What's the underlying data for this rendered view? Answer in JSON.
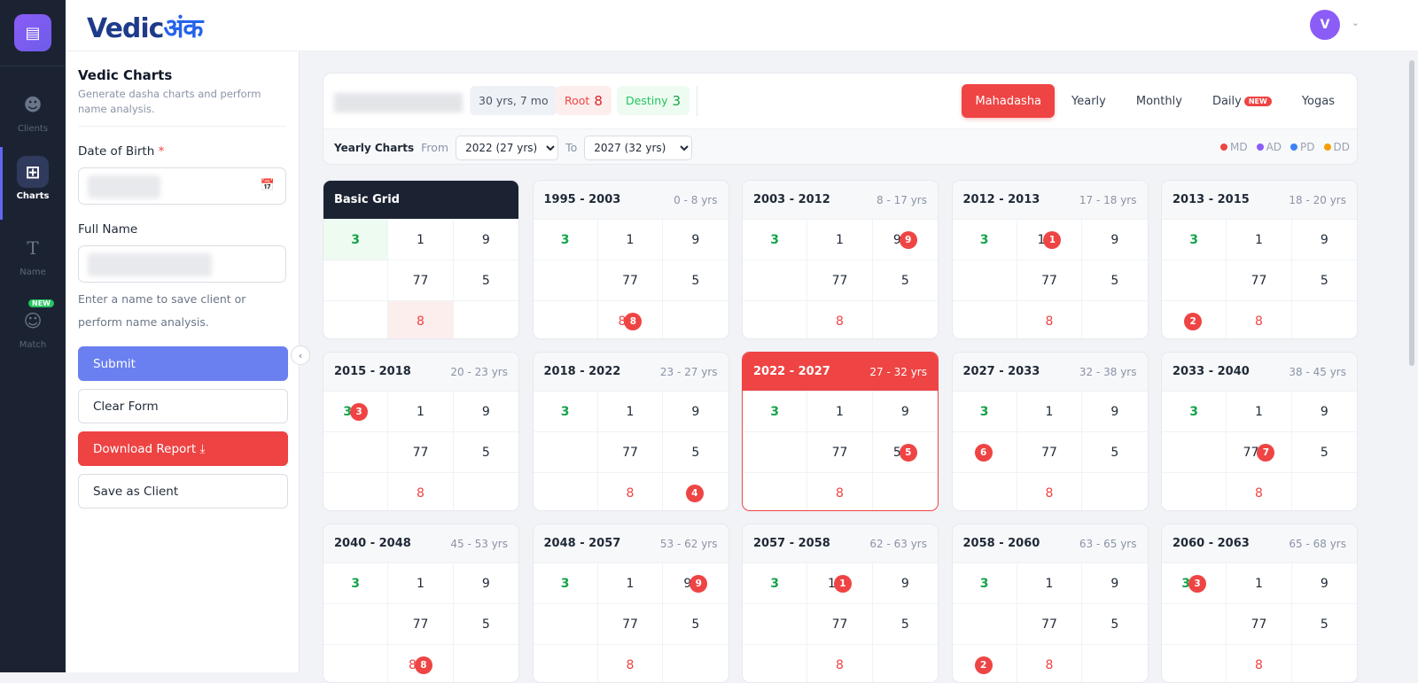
{
  "rail": {
    "items": [
      {
        "label": "Clients",
        "icon": "user-plus-icon"
      },
      {
        "label": "Charts",
        "icon": "grid-icon",
        "active": true
      },
      {
        "label": "Name",
        "icon": "text-icon"
      },
      {
        "label": "Match",
        "icon": "users-icon",
        "badge": "NEW"
      }
    ]
  },
  "brand": {
    "latin": "Vedic",
    "devanagari": "अंक"
  },
  "user": {
    "initial": "V"
  },
  "form": {
    "title": "Vedic Charts",
    "subtitle": "Generate dasha charts and perform name analysis.",
    "dob_label": "Date of Birth",
    "required": "*",
    "name_label": "Full Name",
    "hint": "Enter a name to save client or perform name analysis.",
    "submit": "Submit",
    "clear": "Clear Form",
    "download": "Download Report",
    "save": "Save as Client"
  },
  "summary": {
    "age": "30 yrs, 7 mo",
    "root_label": "Root",
    "root": "8",
    "destiny_label": "Destiny",
    "destiny": "3"
  },
  "tabs": [
    {
      "label": "Mahadasha",
      "active": true
    },
    {
      "label": "Yearly"
    },
    {
      "label": "Monthly"
    },
    {
      "label": "Daily",
      "badge": "NEW"
    },
    {
      "label": "Yogas"
    }
  ],
  "filter": {
    "title": "Yearly Charts",
    "from_label": "From",
    "from": "2022 (27 yrs)",
    "to_label": "To",
    "to": "2027 (32 yrs)"
  },
  "legend": [
    {
      "label": "MD",
      "color": "#ef4444"
    },
    {
      "label": "AD",
      "color": "#8b5cf6"
    },
    {
      "label": "PD",
      "color": "#3b82f6"
    },
    {
      "label": "DD",
      "color": "#f59e0b"
    }
  ],
  "base_cells": [
    "3",
    "1",
    "9",
    "",
    "77",
    "5",
    "",
    "8",
    ""
  ],
  "cards": [
    {
      "title": "Basic Grid",
      "basic": true
    },
    {
      "title": "1995 - 2003",
      "years": "0 - 8 yrs",
      "badge": "8",
      "cell": 7
    },
    {
      "title": "2003 - 2012",
      "years": "8 - 17 yrs",
      "badge": "9",
      "cell": 2
    },
    {
      "title": "2012 - 2013",
      "years": "17 - 18 yrs",
      "badge": "1",
      "cell": 1
    },
    {
      "title": "2013 - 2015",
      "years": "18 - 20 yrs",
      "badge": "2",
      "cell": 6
    },
    {
      "title": "2015 - 2018",
      "years": "20 - 23 yrs",
      "badge": "3",
      "cell": 0
    },
    {
      "title": "2018 - 2022",
      "years": "23 - 27 yrs",
      "badge": "4",
      "cell": 8
    },
    {
      "title": "2022 - 2027",
      "years": "27 - 32 yrs",
      "badge": "5",
      "cell": 5,
      "active": true
    },
    {
      "title": "2027 - 2033",
      "years": "32 - 38 yrs",
      "badge": "6",
      "cell": 3
    },
    {
      "title": "2033 - 2040",
      "years": "38 - 45 yrs",
      "badge": "7",
      "cell": 4
    },
    {
      "title": "2040 - 2048",
      "years": "45 - 53 yrs",
      "badge": "8",
      "cell": 7
    },
    {
      "title": "2048 - 2057",
      "years": "53 - 62 yrs",
      "badge": "9",
      "cell": 2
    },
    {
      "title": "2057 - 2058",
      "years": "62 - 63 yrs",
      "badge": "1",
      "cell": 1
    },
    {
      "title": "2058 - 2060",
      "years": "63 - 65 yrs",
      "badge": "2",
      "cell": 6
    },
    {
      "title": "2060 - 2063",
      "years": "65 - 68 yrs",
      "badge": "3",
      "cell": 0
    }
  ]
}
